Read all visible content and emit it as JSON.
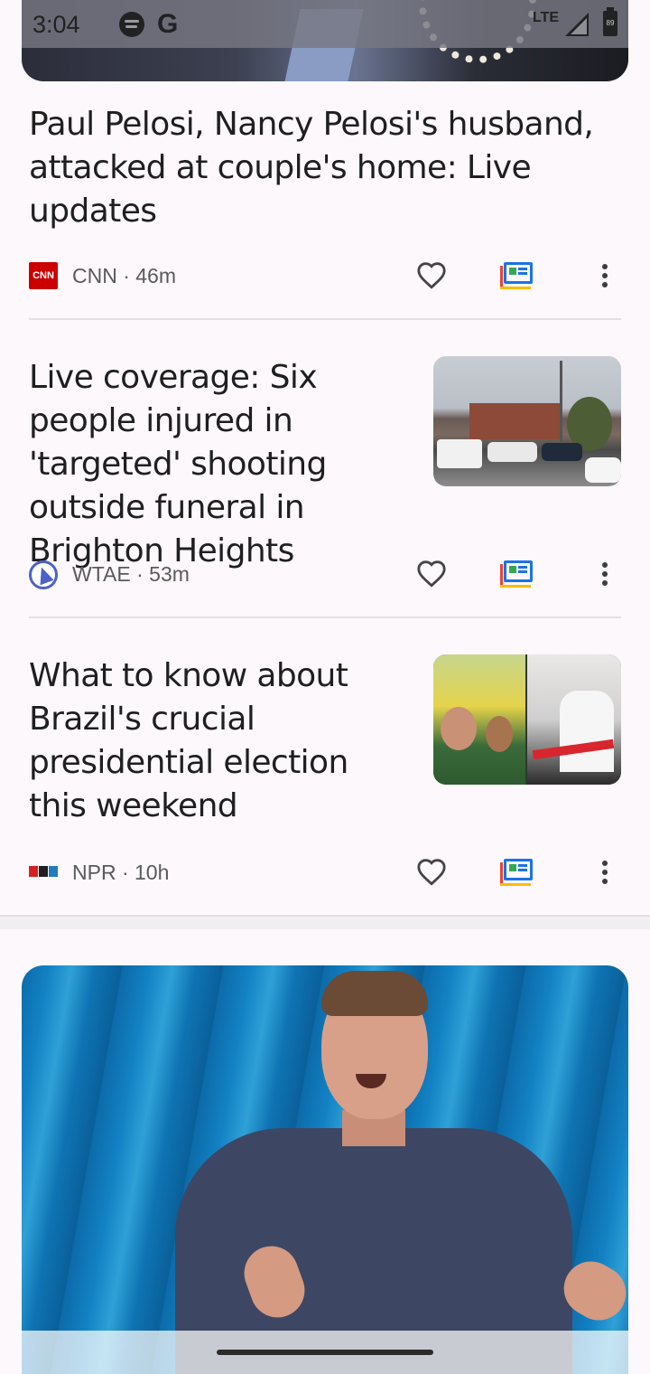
{
  "status_bar": {
    "time": "3:04",
    "google_letter": "G",
    "network": "LTE",
    "battery_level": "89"
  },
  "articles": [
    {
      "headline": "Paul Pelosi, Nancy Pelosi's husband, attacked at couple's home: Live updates",
      "source_logo_text": "CNN",
      "source_meta": "CNN · 46m"
    },
    {
      "headline": "Live coverage: Six people injured in 'targeted' shooting outside funeral in Brighton Heights",
      "source_meta": "WTAE · 53m"
    },
    {
      "headline": "What to know about Brazil's crucial presidential election this weekend",
      "source_meta": "NPR · 10h"
    }
  ],
  "colors": {
    "background": "#fdf8fb",
    "cnn_red": "#cc0000",
    "wtae_blue": "#4c61c8",
    "full_coverage_blue": "#1a73e8"
  },
  "icons": {
    "like": "heart-icon",
    "full_coverage": "full-coverage-icon",
    "more": "more-vert-icon"
  }
}
